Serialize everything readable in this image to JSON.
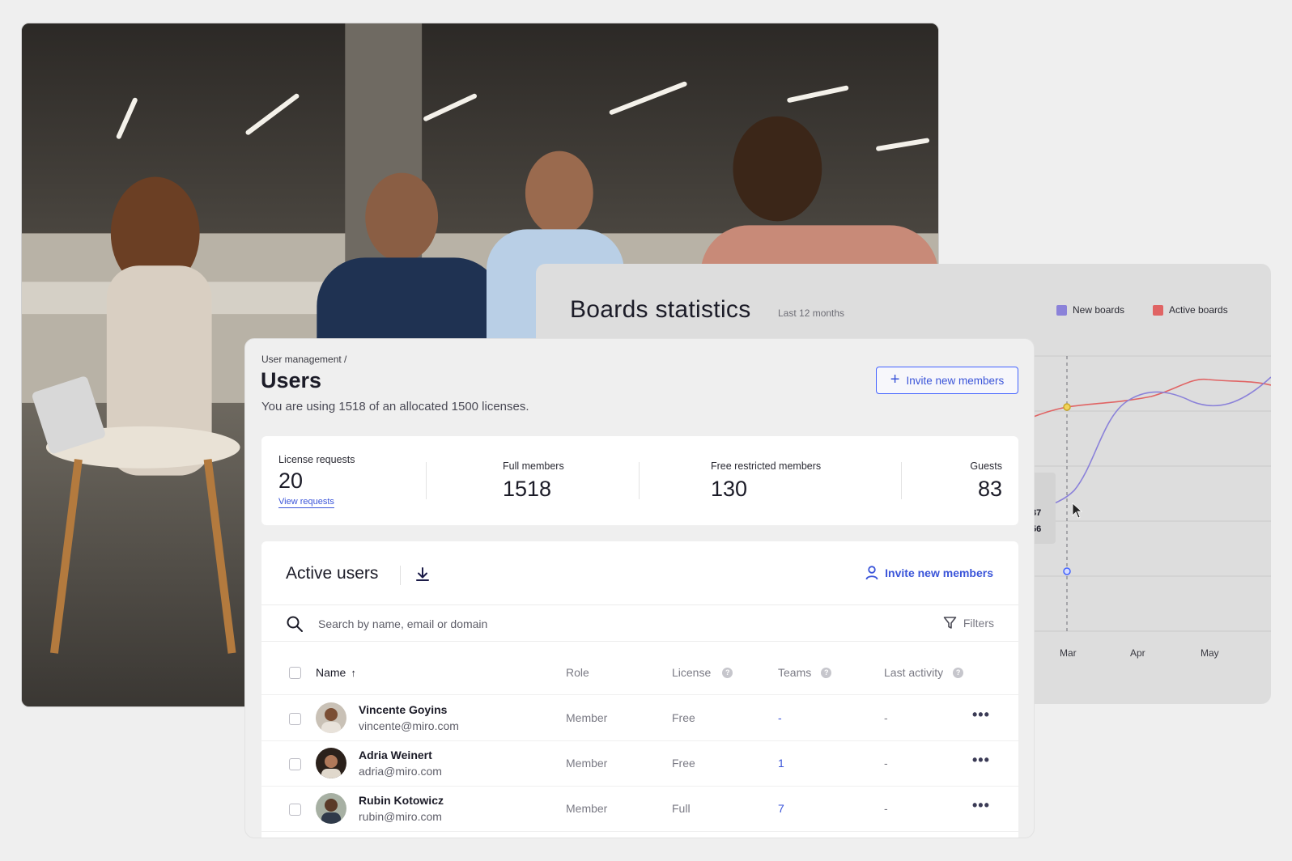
{
  "photo": {
    "description_icon": "office-meeting-photo"
  },
  "boards_stats": {
    "title": "Boards statistics",
    "subtitle": "Last 12 months",
    "legend": [
      {
        "label": "New boards",
        "color": "#8b82d9"
      },
      {
        "label": "Active boards",
        "color": "#e06464"
      }
    ],
    "tooltip_values": [
      "37",
      "56"
    ],
    "x_labels": [
      "Mar",
      "Apr",
      "May"
    ]
  },
  "users_panel": {
    "breadcrumb": "User management /",
    "title": "Users",
    "license_note": "You are using 1518 of an allocated 1500 licenses.",
    "invite_button": "Invite new members",
    "stats": {
      "license_requests": {
        "label": "License requests",
        "value": "20",
        "link": "View requests"
      },
      "full_members": {
        "label": "Full members",
        "value": "1518"
      },
      "free_restricted": {
        "label": "Free restricted members",
        "value": "130"
      },
      "guests": {
        "label": "Guests",
        "value": "83"
      }
    },
    "active_users": {
      "title": "Active users",
      "invite_link": "Invite new members",
      "search_placeholder": "Search by name, email or domain",
      "filters_label": "Filters",
      "columns": {
        "name": "Name",
        "role": "Role",
        "license": "License",
        "teams": "Teams",
        "last_activity": "Last activity"
      },
      "rows": [
        {
          "name": "Vincente Goyins",
          "email": "vincente@miro.com",
          "role": "Member",
          "license": "Free",
          "teams": "-",
          "last_activity": "-"
        },
        {
          "name": "Adria Weinert",
          "email": "adria@miro.com",
          "role": "Member",
          "license": "Free",
          "teams": "1",
          "last_activity": "-"
        },
        {
          "name": "Rubin Kotowicz",
          "email": "rubin@miro.com",
          "role": "Member",
          "license": "Full",
          "teams": "7",
          "last_activity": "-"
        }
      ]
    }
  },
  "colors": {
    "accent": "#4262ff",
    "link": "#3b55d9",
    "new_boards_line": "#8b82d9",
    "active_boards_line": "#e06464"
  }
}
